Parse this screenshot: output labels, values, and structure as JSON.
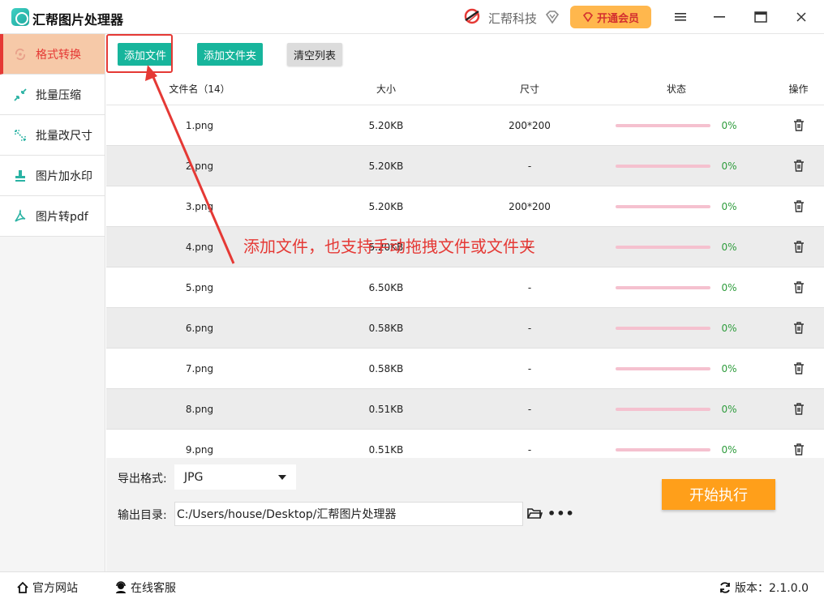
{
  "app": {
    "title": "汇帮图片处理器",
    "brand": "汇帮科技",
    "vip_label": "开通会员"
  },
  "sidebar": {
    "items": [
      {
        "label": "格式转换",
        "icon": "convert-icon",
        "active": true
      },
      {
        "label": "批量压缩",
        "icon": "compress-icon"
      },
      {
        "label": "批量改尺寸",
        "icon": "resize-icon"
      },
      {
        "label": "图片加水印",
        "icon": "stamp-icon"
      },
      {
        "label": "图片转pdf",
        "icon": "pdf-icon"
      }
    ]
  },
  "toolbar": {
    "add_file": "添加文件",
    "add_folder": "添加文件夹",
    "clear_list": "清空列表"
  },
  "table": {
    "headers": {
      "name": "文件名（14）",
      "size": "大小",
      "dim": "尺寸",
      "status": "状态",
      "op": "操作"
    },
    "rows": [
      {
        "name": "1.png",
        "size": "5.20KB",
        "dim": "200*200",
        "progress": "0%"
      },
      {
        "name": "2.png",
        "size": "5.20KB",
        "dim": "-",
        "progress": "0%"
      },
      {
        "name": "3.png",
        "size": "5.20KB",
        "dim": "200*200",
        "progress": "0%"
      },
      {
        "name": "4.png",
        "size": "5.20KB",
        "dim": "-",
        "progress": "0%"
      },
      {
        "name": "5.png",
        "size": "6.50KB",
        "dim": "-",
        "progress": "0%"
      },
      {
        "name": "6.png",
        "size": "0.58KB",
        "dim": "-",
        "progress": "0%"
      },
      {
        "name": "7.png",
        "size": "0.58KB",
        "dim": "-",
        "progress": "0%"
      },
      {
        "name": "8.png",
        "size": "0.51KB",
        "dim": "-",
        "progress": "0%"
      },
      {
        "name": "9.png",
        "size": "0.51KB",
        "dim": "-",
        "progress": "0%"
      }
    ]
  },
  "output": {
    "format_label": "导出格式:",
    "format_value": "JPG",
    "dir_label": "输出目录:",
    "dir_value": "C:/Users/house/Desktop/汇帮图片处理器",
    "start": "开始执行"
  },
  "statusbar": {
    "website": "官方网站",
    "support": "在线客服",
    "version": "版本：2.1.0.0"
  },
  "annotation": "添加文件，也支持手动拖拽文件或文件夹",
  "colors": {
    "accent": "#17b59c",
    "active_red": "#e53935",
    "start_orange": "#ff9f1a",
    "progress_green": "#2e9c3c"
  }
}
